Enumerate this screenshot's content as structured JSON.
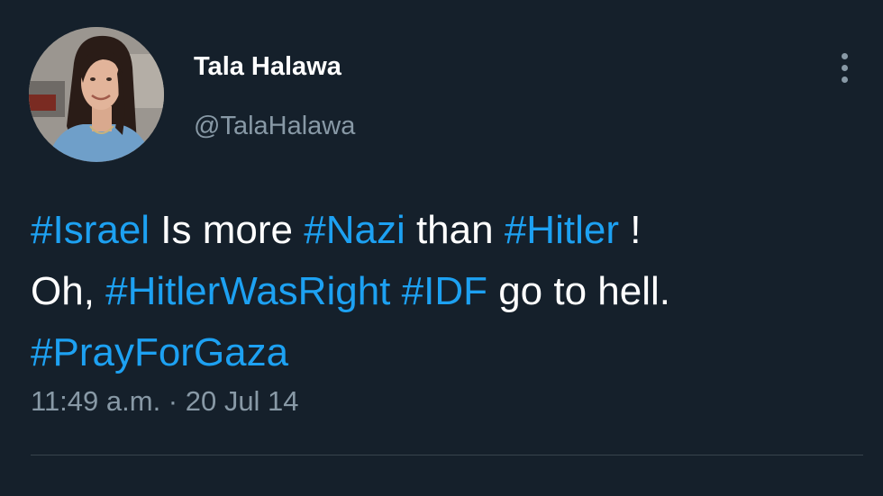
{
  "user": {
    "display_name": "Tala Halawa",
    "handle": "@TalaHalawa",
    "avatar_icon": "profile-photo"
  },
  "menu": {
    "icon": "more-vertical-icon"
  },
  "tweet": {
    "line1": {
      "tag1": "#Israel",
      "text1": " Is more ",
      "tag2": "#Nazi",
      "text2": " than ",
      "tag3": "#Hitler",
      "text3": " !"
    },
    "line2": {
      "text1": "Oh, ",
      "tag1": "#HitlerWasRight",
      "text2": " ",
      "tag2": "#IDF",
      "text3": " go to hell."
    },
    "line3": {
      "tag1": "#PrayForGaza"
    },
    "timestamp": "11:49 a.m. · 20 Jul 14"
  },
  "colors": {
    "background": "#15202b",
    "text": "#ffffff",
    "secondary": "#8899a6",
    "hashtag": "#1da1f2",
    "divider": "#38444d"
  }
}
